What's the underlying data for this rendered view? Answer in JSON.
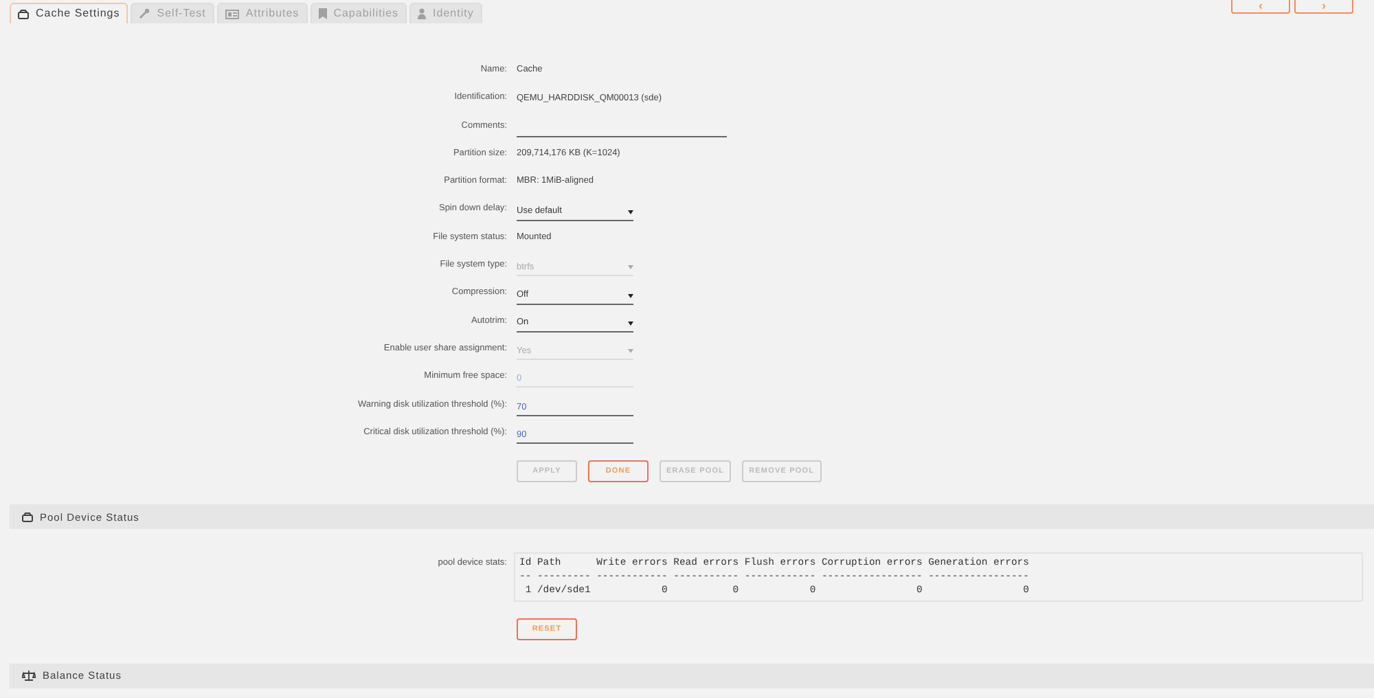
{
  "tabs": [
    {
      "label": "Cache Settings",
      "kind": "drive",
      "selected": true
    },
    {
      "label": "Self-Test",
      "kind": "wrench",
      "selected": false
    },
    {
      "label": "Attributes",
      "kind": "card",
      "selected": false
    },
    {
      "label": "Capabilities",
      "kind": "bookmark",
      "selected": false
    },
    {
      "label": "Identity",
      "kind": "user",
      "selected": false
    }
  ],
  "nav_buttons": [
    {
      "label": "‹"
    },
    {
      "label": "›"
    }
  ],
  "settings": [
    {
      "label": "Name:",
      "kind": "text",
      "value": "Cache"
    },
    {
      "label": "Identification:",
      "kind": "text",
      "value": "QEMU_HARDDISK_QM00013 (sde)"
    },
    {
      "label": "Comments:",
      "kind": "comment",
      "disabled": false
    },
    {
      "label": "Partition size:",
      "kind": "text",
      "value": "209,714,176 KB (K=1024)"
    },
    {
      "label": "Partition format:",
      "kind": "text",
      "value": "MBR: 1MiB-aligned"
    },
    {
      "label": "Spin down delay:",
      "kind": "select",
      "value": "Use default",
      "disabled": false
    },
    {
      "label": "File system status:",
      "kind": "text",
      "value": "Mounted"
    },
    {
      "label": "File system type:",
      "kind": "select",
      "value": "btrfs",
      "disabled": true
    },
    {
      "label": "Compression:",
      "kind": "select",
      "value": "Off",
      "disabled": false
    },
    {
      "label": "Autotrim:",
      "kind": "select",
      "value": "On",
      "disabled": false
    },
    {
      "label": "Enable user share assignment:",
      "kind": "select",
      "value": "Yes",
      "disabled": true
    },
    {
      "label": "Minimum free space:",
      "kind": "input",
      "value": "0",
      "disabled": true
    },
    {
      "label": "Warning disk utilization threshold (%):",
      "kind": "input",
      "value": "70",
      "disabled": false
    },
    {
      "label": "Critical disk utilization threshold (%):",
      "kind": "input",
      "value": "90",
      "disabled": false
    }
  ],
  "actions": [
    {
      "label": "APPLY",
      "disabled": true
    },
    {
      "label": "DONE",
      "disabled": false
    },
    {
      "label": "ERASE POOL",
      "disabled": true
    },
    {
      "label": "REMOVE POOL",
      "disabled": true
    }
  ],
  "pool_device_status": {
    "title": "Pool Device Status",
    "stats_label": "pool device stats:",
    "stats_lines": [
      "Id Path      Write errors Read errors Flush errors Corruption errors Generation errors",
      "-- --------- ------------ ----------- ------------ ----------------- -----------------",
      " 1 /dev/sde1            0           0            0                 0                 0"
    ],
    "reset_button": "RESET"
  },
  "balance_status": {
    "title": "Balance Status"
  }
}
